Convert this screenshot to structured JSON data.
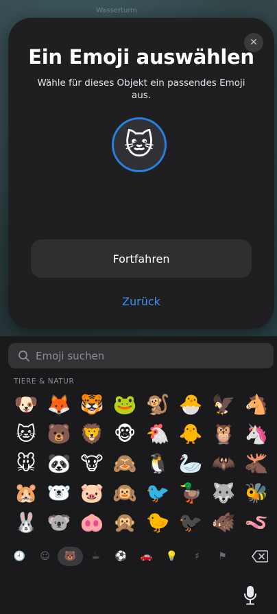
{
  "dialog": {
    "title": "Ein Emoji auswählen",
    "subtitle": "Wähle für dieses Objekt ein passendes Emoji aus.",
    "selected_emoji": "🐱",
    "continue_label": "Fortfahren",
    "back_label": "Zurück",
    "accent_color": "#3e8ef7"
  },
  "keyboard": {
    "search_placeholder": "Emoji suchen",
    "section_label": "TIERE & NATUR",
    "emojis": [
      "🐶",
      "🦊",
      "🐯",
      "🐸",
      "🐒",
      "🐣",
      "🦅",
      "🐴",
      "🐱",
      "🐻",
      "🦁",
      "🐵",
      "🐔",
      "🐥",
      "🦉",
      "🦄",
      "🐭",
      "🐼",
      "🐮",
      "🙈",
      "🐧",
      "🦢",
      "🦇",
      "🫎",
      "🐹",
      "🐻‍❄️",
      "🐷",
      "🙉",
      "🐦",
      "🦆",
      "🐺",
      "🐝",
      "🐰",
      "🐨",
      "🐽",
      "🙊",
      "🐤",
      "🐦‍⬛",
      "🐗",
      "🪱"
    ],
    "categories": [
      {
        "name": "recent-icon",
        "glyph": "🕘"
      },
      {
        "name": "smileys-icon",
        "glyph": "☺"
      },
      {
        "name": "animals-icon",
        "glyph": "🐻"
      },
      {
        "name": "food-icon",
        "glyph": "☕"
      },
      {
        "name": "activity-icon",
        "glyph": "⚽"
      },
      {
        "name": "travel-icon",
        "glyph": "🚗"
      },
      {
        "name": "objects-icon",
        "glyph": "💡"
      },
      {
        "name": "symbols-icon",
        "glyph": "♯"
      },
      {
        "name": "flags-icon",
        "glyph": "⚑"
      }
    ]
  },
  "map_labels": [
    "Wasserturm"
  ]
}
